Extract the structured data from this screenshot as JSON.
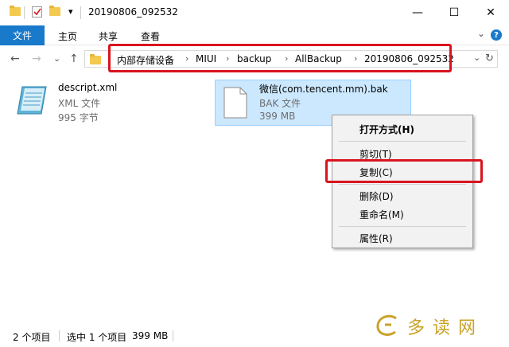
{
  "titlebar": {
    "title": "20190806_092532",
    "qat_dropdown": "▾",
    "minimize": "—",
    "maximize": "☐",
    "close": "✕"
  },
  "ribbon": {
    "tabs": [
      "文件",
      "主页",
      "共享",
      "查看"
    ],
    "collapse": "⌄",
    "help": "?"
  },
  "address": {
    "back": "←",
    "forward": "→",
    "recent": "⌄",
    "up": "↑",
    "crumbs": [
      "内部存储设备",
      "MIUI",
      "backup",
      "AllBackup",
      "20190806_092532"
    ],
    "separator": "›",
    "dropdown": "⌄",
    "refresh": "↻"
  },
  "files": [
    {
      "name": "descript.xml",
      "type": "XML 文件",
      "size": "995 字节",
      "icon": "notepad-icon"
    },
    {
      "name": "微信(com.tencent.mm).bak",
      "type": "BAK 文件",
      "size": "399 MB",
      "icon": "document-icon"
    }
  ],
  "context_menu": {
    "items": [
      "打开方式(H)",
      "剪切(T)",
      "复制(C)",
      "删除(D)",
      "重命名(M)",
      "属性(R)"
    ]
  },
  "status": {
    "item_count": "2 个项目",
    "selection": "选中 1 个项目",
    "selection_size": "399 MB"
  },
  "watermark": {
    "text": "多读网"
  },
  "colors": {
    "accent": "#1979ca",
    "selection": "#cce8ff",
    "highlight_box": "#d9141e"
  }
}
